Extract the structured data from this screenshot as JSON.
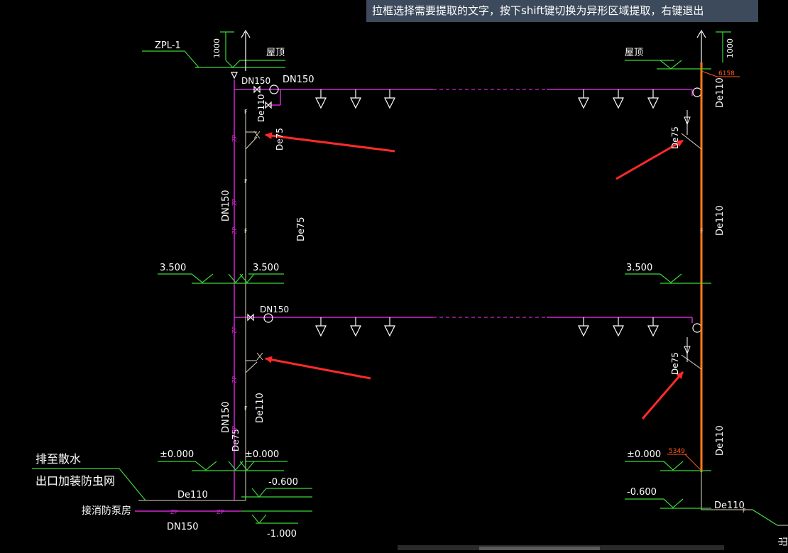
{
  "app": {
    "hint": "拉框选择需要提取的文字，按下shift键切换为异形区域提取，右键退出"
  },
  "labels": {
    "zpl": "ZPL-1",
    "dim_1000": "1000",
    "roof": "屋顶",
    "dn150": "DN150",
    "de110": "De110",
    "de75": "De75",
    "el_3500": "3.500",
    "el_0000": "±0.000",
    "el_m0600": "-0.600",
    "el_m1000": "-1.000",
    "drain_line1": "排至散水",
    "drain_line2": "出口加装防虫网",
    "pump": "接消防泵房",
    "zp": "ZP",
    "f": "F",
    "marker_top": "6158",
    "marker_bottom": "5349",
    "out": "出"
  }
}
